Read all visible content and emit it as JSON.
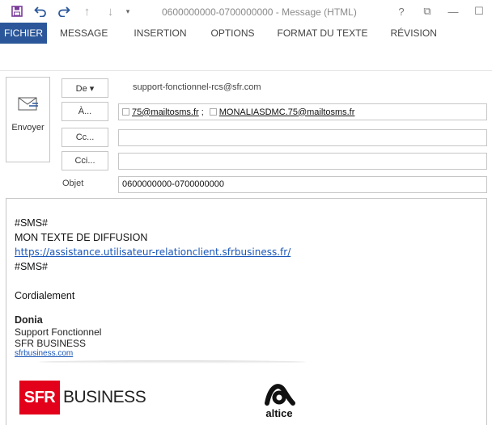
{
  "window": {
    "title": "0600000000-0700000000 - Message (HTML)",
    "controls": {
      "help": "?",
      "restore": "⧉",
      "minimize": "—",
      "maximize": "☐"
    }
  },
  "quick_access": {
    "save_icon": "save-icon",
    "undo_icon": "undo-icon",
    "redo_icon": "redo-icon",
    "up_icon": "arrow-up-icon",
    "down_icon": "arrow-down-icon",
    "customize_icon": "dropdown-icon"
  },
  "ribbon": {
    "tabs": [
      {
        "label": "FICHIER",
        "active": true
      },
      {
        "label": "MESSAGE"
      },
      {
        "label": "INSERTION"
      },
      {
        "label": "OPTIONS"
      },
      {
        "label": "FORMAT DU TEXTE"
      },
      {
        "label": "RÉVISION"
      }
    ]
  },
  "compose": {
    "send_label": "Envoyer",
    "from_label": "De ▾",
    "from_value": "support-fonctionnel-rcs@sfr.com",
    "to_label": "À...",
    "to_recipients": [
      {
        "address": "75@mailtosms.fr",
        "separator": ";"
      },
      {
        "address": "MONALIASDMC.75@mailtosms.fr",
        "separator": ""
      }
    ],
    "cc_label": "Cc...",
    "cc_value": "",
    "bcc_label": "Cci...",
    "bcc_value": "",
    "subject_label": "Objet",
    "subject_value": "0600000000-0700000000"
  },
  "body": {
    "line1": "#SMS#",
    "line2": "MON TEXTE DE DIFFUSION",
    "link": "https://assistance.utilisateur-relationclient.sfrbusiness.fr/",
    "line4": "#SMS#",
    "greeting": "Cordialement",
    "signature": {
      "name": "Donia",
      "role": "Support Fonctionnel",
      "company": "SFR BUSINESS",
      "website": "sfrbusiness.com"
    },
    "logos": {
      "sfr_box": "SFR",
      "sfr_business": "BUSINESS",
      "altice": "altice"
    }
  },
  "colors": {
    "accent": "#2b579a",
    "link": "#1a56b8",
    "sfr_red": "#e2001a"
  }
}
